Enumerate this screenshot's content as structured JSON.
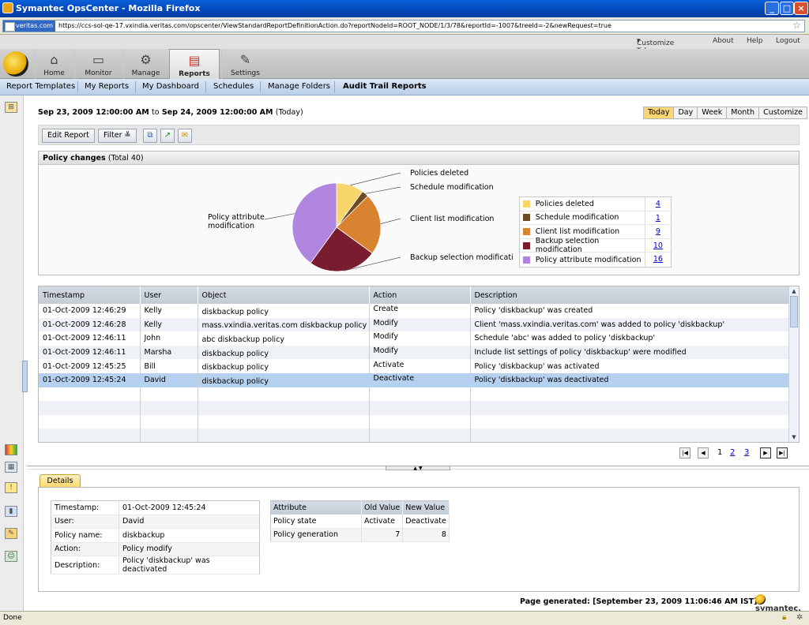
{
  "window": {
    "title": "Symantec OpsCenter - Mozilla Firefox"
  },
  "address": {
    "site": "veritas.com",
    "url": "https://ccs-sol-qe-17.vxindia.veritas.com/opscenter/ViewStandardReportDefinitionAction.do?reportNodeId=ROOT_NODE/1/3/78&reportId=-1007&treeId=-2&newRequest=true"
  },
  "top_links": {
    "customize": "Customize Tabs",
    "about": "About",
    "help": "Help",
    "logout": "Logout"
  },
  "nav": {
    "home": "Home",
    "monitor": "Monitor",
    "manage": "Manage",
    "reports": "Reports",
    "settings": "Settings"
  },
  "subnav": [
    "Report Templates",
    "My Reports",
    "My Dashboard",
    "Schedules",
    "Manage Folders",
    "Audit Trail Reports"
  ],
  "date_range": {
    "from": "Sep 23, 2009 12:00:00 AM",
    "to_word": "to",
    "to": "Sep 24, 2009 12:00:00 AM",
    "suffix": "(Today)"
  },
  "range_buttons": [
    "Today",
    "Day",
    "Week",
    "Month",
    "Customize"
  ],
  "toolbar": {
    "edit": "Edit Report",
    "filter": "Filter"
  },
  "panel": {
    "title": "Policy changes",
    "total": "(Total 40)"
  },
  "chart_data": {
    "type": "pie",
    "categories": [
      "Policies deleted",
      "Schedule modification",
      "Client list modification",
      "Backup selection modification",
      "Policy attribute modification"
    ],
    "values": [
      4,
      1,
      9,
      10,
      16
    ],
    "colors": [
      "#f7d56b",
      "#6e4a24",
      "#d9822f",
      "#7a1c30",
      "#b085e0"
    ],
    "slice_labels": [
      "Policies deleted",
      "Schedule modification",
      "Client list modification",
      "Backup selection modification",
      "Policy attribute modification"
    ]
  },
  "grid": {
    "columns": [
      "Timestamp",
      "User",
      "Object",
      "Action",
      "Description"
    ],
    "rows": [
      [
        "01-Oct-2009 12:46:29",
        "Kelly",
        "diskbackup policy",
        "Create",
        "Policy 'diskbackup' was created"
      ],
      [
        "01-Oct-2009 12:46:28",
        "Kelly",
        "mass.vxindia.veritas.com diskbackup policy",
        "Modify",
        "Client 'mass.vxindia.veritas.com' was added to policy 'diskbackup'"
      ],
      [
        "01-Oct-2009 12:46:11",
        "John",
        "abc diskbackup policy",
        "Modify",
        "Schedule 'abc' was added to policy 'diskbackup'"
      ],
      [
        "01-Oct-2009 12:46:11",
        "Marsha",
        "diskbackup policy",
        "Modify",
        "Include list settings of policy 'diskbackup' were modified"
      ],
      [
        "01-Oct-2009 12:45:25",
        "Bill",
        "diskbackup policy",
        "Activate",
        "Policy 'diskbackup' was activated"
      ],
      [
        "01-Oct-2009 12:45:24",
        "David",
        "diskbackup policy",
        "Deactivate",
        "Policy 'diskbackup' was deactivated"
      ]
    ],
    "selected_row": 5
  },
  "pager": {
    "pages": [
      "1",
      "2",
      "3"
    ],
    "current": "1"
  },
  "details": {
    "tab": "Details",
    "info": [
      [
        "Timestamp:",
        "01-Oct-2009 12:45:24"
      ],
      [
        "User:",
        "David"
      ],
      [
        "Policy name:",
        "diskbackup"
      ],
      [
        "Action:",
        "Policy modify"
      ],
      [
        "Description:",
        "Policy 'diskbackup' was deactivated"
      ]
    ],
    "attr_columns": [
      "Attribute",
      "Old Value",
      "New Value"
    ],
    "attr_rows": [
      [
        "Policy state",
        "Activate",
        "Deactivate"
      ],
      [
        "Policy generation",
        "7",
        "8"
      ]
    ]
  },
  "footer": {
    "page_generated": "Page generated: [September 23, 2009 11:06:46 AM IST]",
    "brand": "symantec."
  },
  "status": {
    "text": "Done"
  }
}
